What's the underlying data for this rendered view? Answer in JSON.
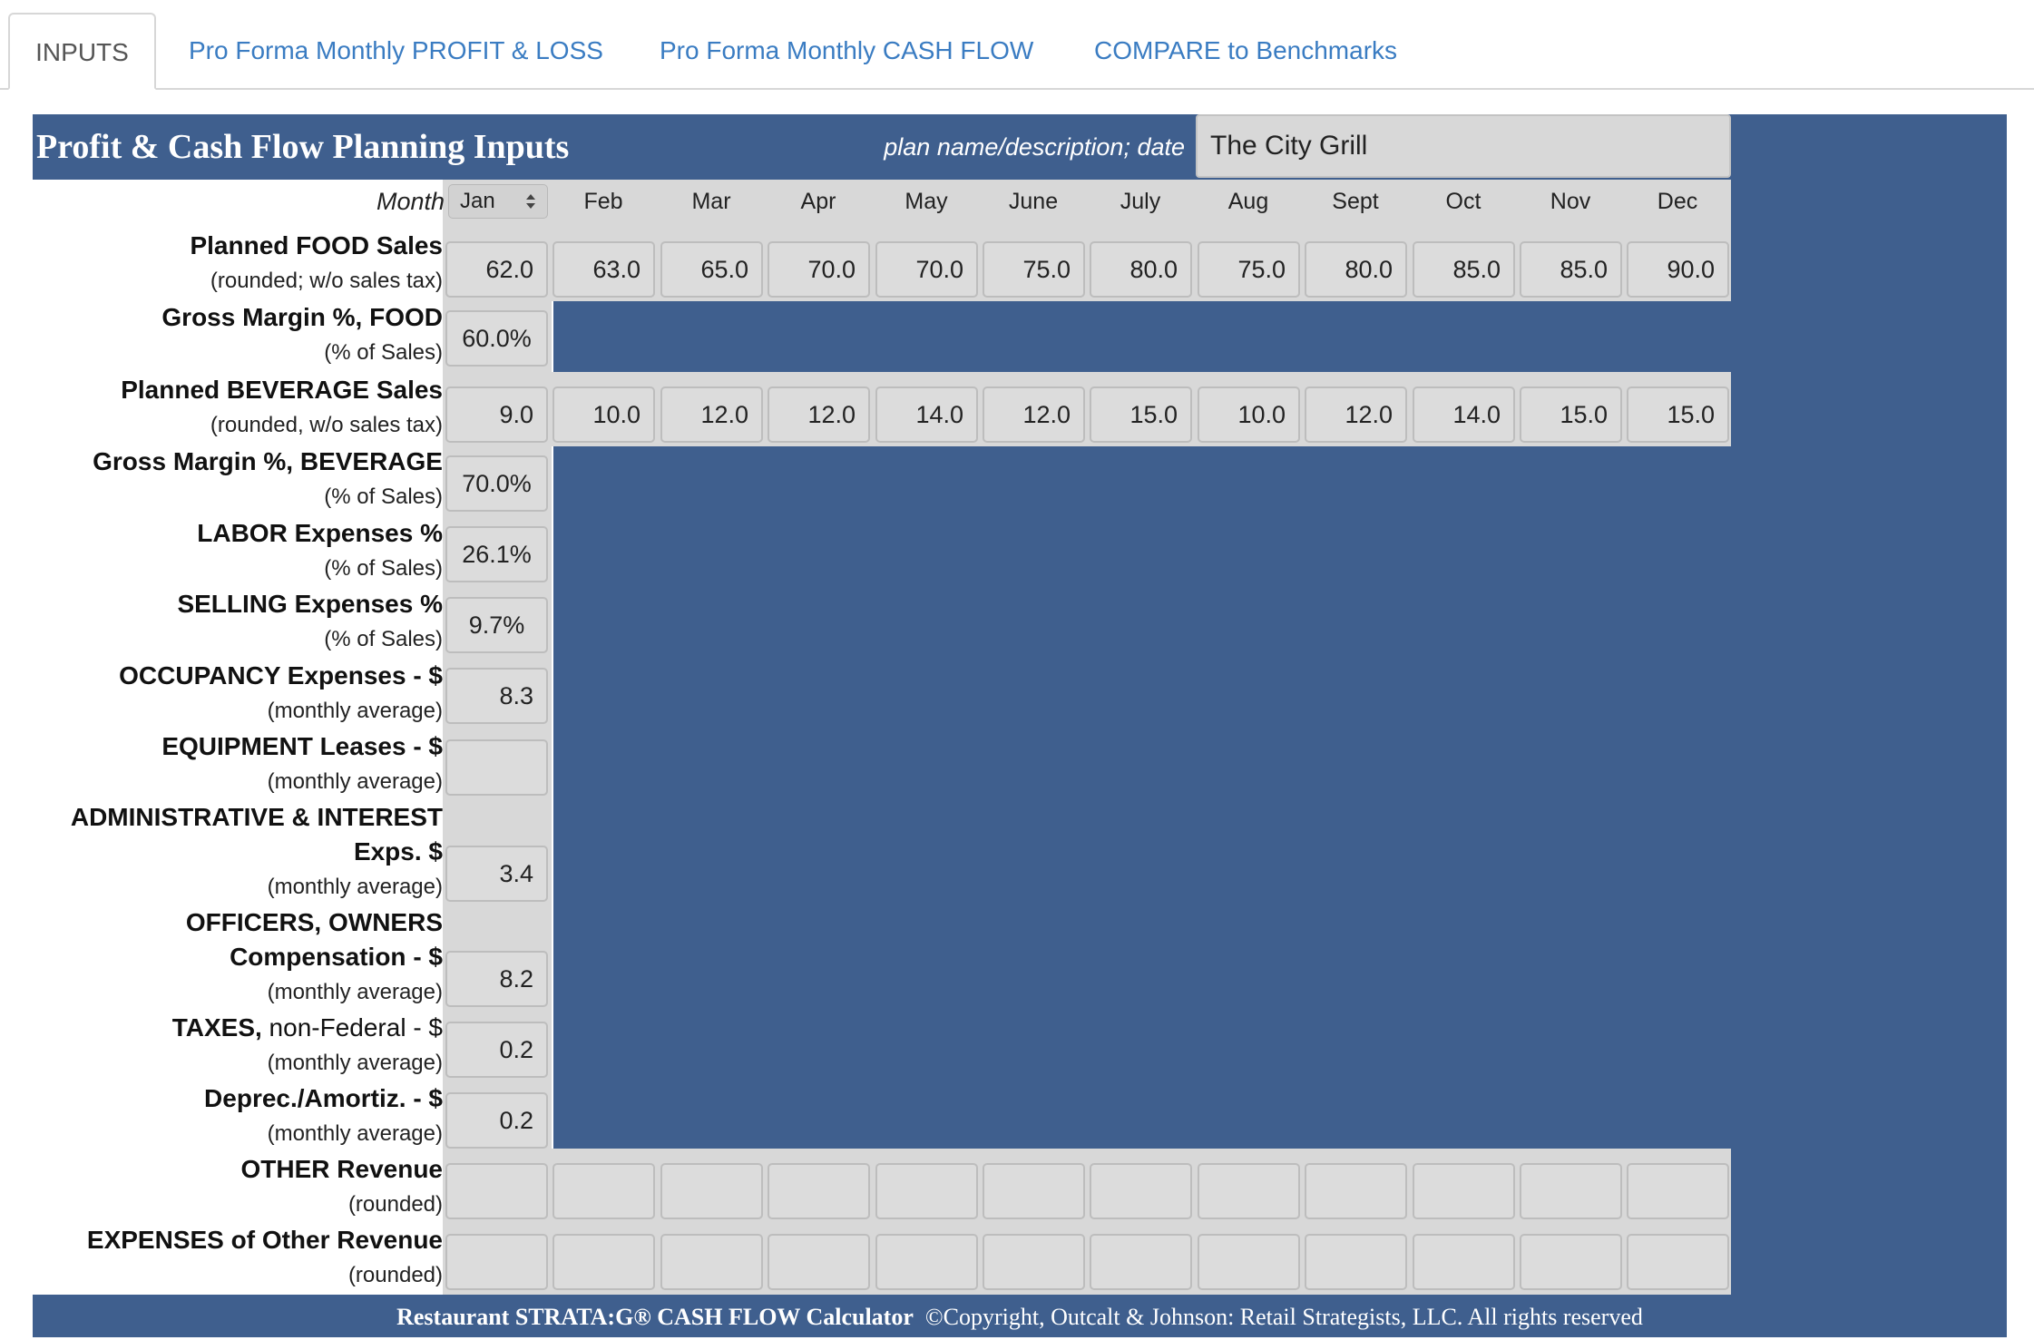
{
  "tabs": [
    {
      "label": "INPUTS",
      "active": true
    },
    {
      "label": "Pro Forma Monthly PROFIT & LOSS",
      "active": false
    },
    {
      "label": "Pro Forma Monthly CASH FLOW",
      "active": false
    },
    {
      "label": "COMPARE to Benchmarks",
      "active": false
    }
  ],
  "header": {
    "title": "Profit & Cash Flow Planning Inputs",
    "plan_label": "plan name/description; date",
    "plan_value": "The City Grill"
  },
  "month_row": {
    "label": "Month",
    "selected": "Jan",
    "months": [
      "Feb",
      "Mar",
      "Apr",
      "May",
      "June",
      "July",
      "Aug",
      "Sept",
      "Oct",
      "Nov",
      "Dec"
    ]
  },
  "rows": {
    "food_sales": {
      "title": "Planned FOOD Sales",
      "sub": "(rounded; w/o sales tax)",
      "values": [
        "62.0",
        "63.0",
        "65.0",
        "70.0",
        "70.0",
        "75.0",
        "80.0",
        "75.0",
        "80.0",
        "85.0",
        "85.0",
        "90.0"
      ]
    },
    "gm_food": {
      "title": "Gross Margin %, FOOD",
      "sub": "(% of Sales)",
      "value": "60.0%"
    },
    "bev_sales": {
      "title": "Planned BEVERAGE Sales",
      "sub": "(rounded, w/o sales tax)",
      "values": [
        "9.0",
        "10.0",
        "12.0",
        "12.0",
        "14.0",
        "12.0",
        "15.0",
        "10.0",
        "12.0",
        "14.0",
        "15.0",
        "15.0"
      ]
    },
    "gm_bev": {
      "title": "Gross Margin %, BEVERAGE",
      "sub": "(% of Sales)",
      "value": "70.0%"
    },
    "labor": {
      "title": "LABOR Expenses %",
      "sub": "(% of  Sales)",
      "value": "26.1%"
    },
    "selling": {
      "title": "SELLING Expenses %",
      "sub": "(% of Sales)",
      "value": "9.7%"
    },
    "occupancy": {
      "title": "OCCUPANCY Expenses - $",
      "sub": "(monthly average)",
      "value": "8.3"
    },
    "equipment": {
      "title": "EQUIPMENT Leases - $",
      "sub": "(monthly average)",
      "value": ""
    },
    "admin": {
      "title_line1": "ADMINISTRATIVE & INTEREST",
      "title_line2": "Exps. $",
      "sub": "(monthly average)",
      "value": "3.4"
    },
    "officers": {
      "title_line1": "OFFICERS, OWNERS",
      "title_line2": "Compensation - $",
      "sub": "(monthly average)",
      "value": "8.2"
    },
    "taxes": {
      "title_bold": "TAXES,",
      "title_rest": " non-Federal - $",
      "sub": "(monthly average)",
      "value": "0.2"
    },
    "deprec": {
      "title": "Deprec./Amortiz. - $",
      "sub": "(monthly average)",
      "value": "0.2"
    },
    "other_rev": {
      "title": "OTHER Revenue",
      "sub": "(rounded)"
    },
    "exp_other_rev": {
      "title": "EXPENSES of Other Revenue",
      "sub": "(rounded)"
    }
  },
  "footer": {
    "bold": "Restaurant STRATA:G® CASH FLOW Calculator",
    "rest": "©Copyright, Outcalt & Johnson: Retail Strategists, LLC.  All rights reserved"
  },
  "colors": {
    "panel": "#3f5f8e",
    "tab_link": "#3a7cc2",
    "input": "#dcdcdc"
  }
}
